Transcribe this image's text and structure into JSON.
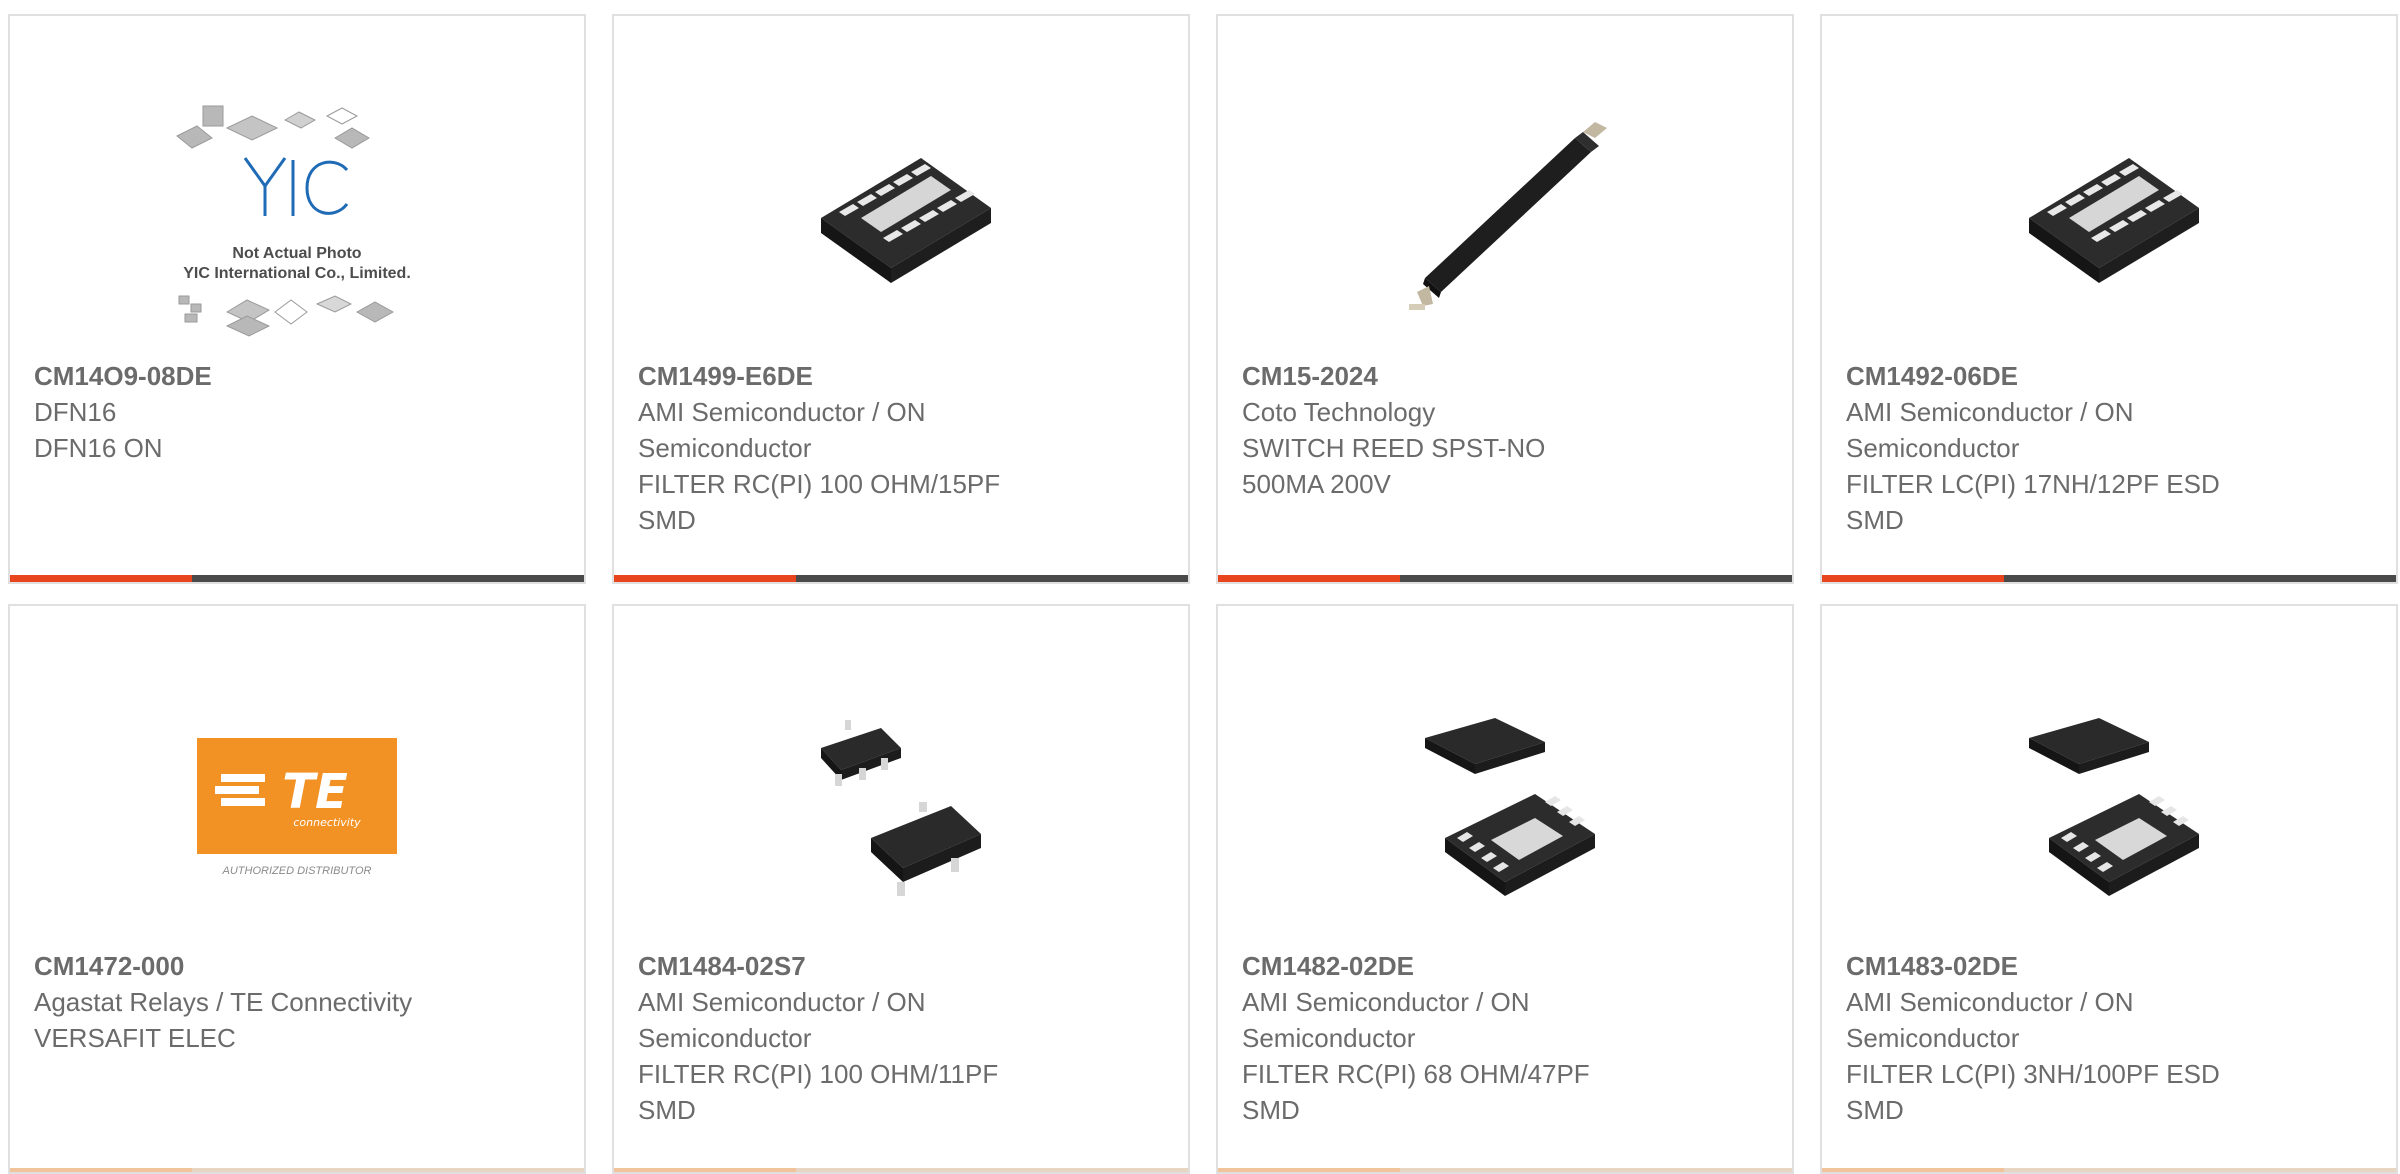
{
  "products": [
    {
      "part_number": "CM14O9-08DE",
      "lines": [
        "DFN16",
        "DFN16 ON"
      ],
      "image": "yic-placeholder",
      "image_caption": [
        "Not Actual Photo",
        "YIC International Co., Limited."
      ]
    },
    {
      "part_number": "CM1499-E6DE",
      "lines": [
        "AMI Semiconductor / ON",
        "Semiconductor",
        "FILTER RC(PI) 100 OHM/15PF",
        "SMD"
      ],
      "image": "dfn-chip-16"
    },
    {
      "part_number": "CM15-2024",
      "lines": [
        "Coto Technology",
        "SWITCH REED SPST-NO",
        "500MA 200V"
      ],
      "image": "reed-switch"
    },
    {
      "part_number": "CM1492-06DE",
      "lines": [
        "AMI Semiconductor / ON",
        "Semiconductor",
        "FILTER LC(PI) 17NH/12PF ESD",
        "SMD"
      ],
      "image": "dfn-chip-16"
    },
    {
      "part_number": "CM1472-000",
      "lines": [
        "Agastat Relays / TE Connectivity",
        "VERSAFIT ELEC"
      ],
      "image": "te-logo",
      "logo_text": {
        "brand": "TE",
        "sub": "connectivity",
        "caption": "AUTHORIZED DISTRIBUTOR"
      }
    },
    {
      "part_number": "CM1484-02S7",
      "lines": [
        "AMI Semiconductor / ON",
        "Semiconductor",
        "FILTER RC(PI) 100 OHM/11PF",
        "SMD"
      ],
      "image": "sot-chip"
    },
    {
      "part_number": "CM1482-02DE",
      "lines": [
        "AMI Semiconductor / ON",
        "Semiconductor",
        "FILTER RC(PI) 68 OHM/47PF",
        "SMD"
      ],
      "image": "udfn-chip-8"
    },
    {
      "part_number": "CM1483-02DE",
      "lines": [
        "AMI Semiconductor / ON",
        "Semiconductor",
        "FILTER LC(PI) 3NH/100PF ESD",
        "SMD"
      ],
      "image": "udfn-chip-8"
    }
  ],
  "colors": {
    "accent": "#e8451e",
    "bar": "#4a4a4a",
    "text": "#6b6b6b",
    "border": "#e0e0e0",
    "te_orange": "#f39224"
  }
}
